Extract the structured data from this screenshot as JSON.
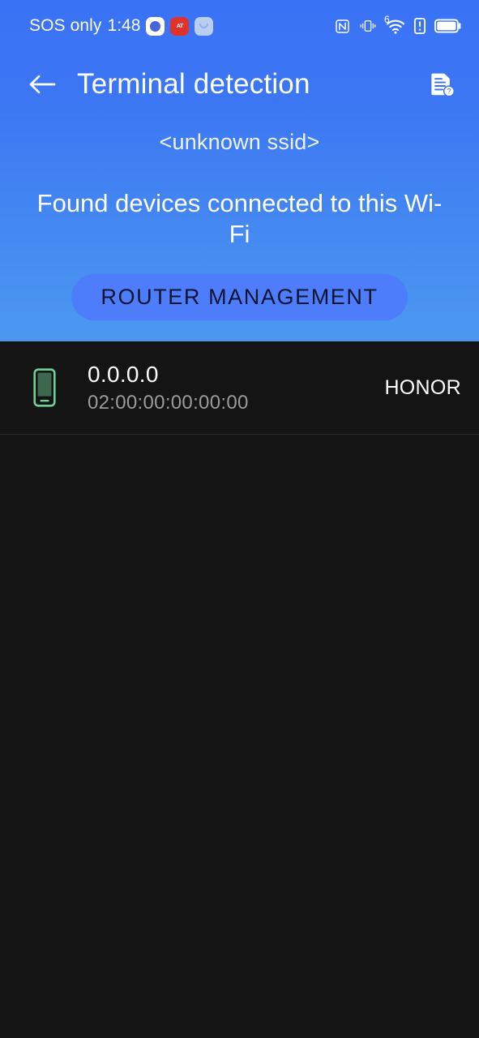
{
  "status_bar": {
    "carrier": "SOS only",
    "time": "1:48",
    "left_icons": [
      {
        "name": "shield-app-icon",
        "label": ""
      },
      {
        "name": "red-app-icon",
        "label": "AT"
      },
      {
        "name": "pale-app-icon",
        "label": ""
      }
    ],
    "right_icons": [
      {
        "name": "nfc-icon"
      },
      {
        "name": "vibrate-icon"
      },
      {
        "name": "wifi-6-icon",
        "label": "6"
      },
      {
        "name": "alert-icon"
      },
      {
        "name": "battery-icon"
      }
    ]
  },
  "appbar": {
    "back_label": "Back",
    "title": "Terminal detection",
    "help_label": "Help"
  },
  "hero": {
    "ssid": "<unknown ssid>",
    "description": "Found devices connected to this Wi-Fi",
    "router_button": "ROUTER MANAGEMENT"
  },
  "devices": [
    {
      "icon": "smartphone-icon",
      "ip": "0.0.0.0",
      "mac": "02:00:00:00:00:00",
      "vendor": "HONOR"
    }
  ],
  "colors": {
    "header_top": "#3a72f5",
    "header_bottom": "#4b97f0",
    "button": "#4d7dfb",
    "button_text": "#0d1430",
    "background": "#141414",
    "device_icon": "#6fcf97",
    "mac_text": "#9b9b9b"
  }
}
